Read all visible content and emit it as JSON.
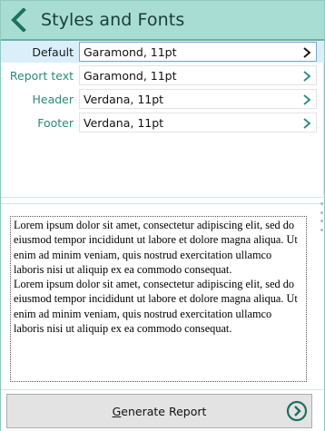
{
  "header": {
    "title": "Styles and Fonts",
    "back_icon": "chevron-left-icon"
  },
  "settings": {
    "rows": [
      {
        "label": "Default",
        "value": "Garamond, 11pt",
        "selected": true
      },
      {
        "label": "Report text",
        "value": "Garamond, 11pt",
        "selected": false
      },
      {
        "label": "Header",
        "value": "Verdana, 11pt",
        "selected": false
      },
      {
        "label": "Footer",
        "value": "Verdana, 11pt",
        "selected": false
      }
    ]
  },
  "preview": {
    "paragraphs": [
      "Lorem ipsum dolor sit amet, consectetur adipiscing elit, sed do eiusmod tempor incididunt ut labore et dolore magna aliqua. Ut enim ad minim veniam, quis nostrud exercitation ullamco laboris nisi ut aliquip ex ea commodo consequat.",
      "Lorem ipsum dolor sit amet, consectetur adipiscing elit, sed do eiusmod tempor incididunt ut labore et dolore magna aliqua. Ut enim ad minim veniam, quis nostrud exercitation ullamco laboris nisi ut aliquip ex ea commodo consequat."
    ]
  },
  "footer": {
    "generate_first_letter": "G",
    "generate_rest": "enerate Report",
    "generate_icon": "circle-chevron-right-icon"
  },
  "colors": {
    "header_bg": "#a8ddd3",
    "accent": "#2a8a7b",
    "selected_row_bg": "#daeffa"
  }
}
